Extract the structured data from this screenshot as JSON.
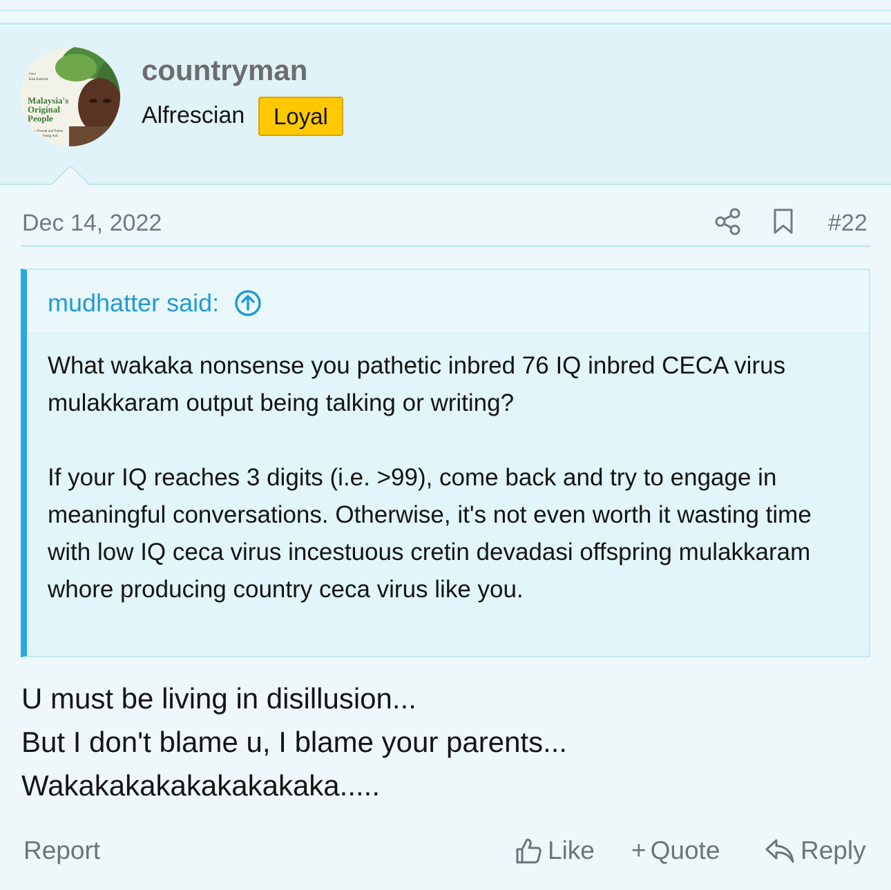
{
  "user": {
    "name": "countryman",
    "title": "Alfrescian",
    "badge": "Loyal",
    "avatar": {
      "cover_title_lines": [
        "Malaysia's",
        "Original",
        "People"
      ],
      "cover_subtitle_lines": [
        "t, Present and Future",
        "Orang Asli"
      ],
      "cover_editor_lines": [
        "Editor",
        "Kirk Endicott"
      ]
    }
  },
  "post": {
    "date": "Dec 14, 2022",
    "number": "#22",
    "quote": {
      "author": "mudhatter said:",
      "paragraphs": [
        "What wakaka nonsense you pathetic inbred 76 IQ inbred CECA virus mulakkaram output being talking or writing?",
        "If your IQ reaches 3 digits (i.e. >99), come back and try to engage in meaningful conversations. Otherwise, it's not even worth it wasting time with low IQ ceca virus incestuous cretin devadasi offspring mulakkaram whore producing country ceca virus like you."
      ]
    },
    "body_lines": [
      "U must be living in disillusion...",
      "But I don't blame u, I blame your parents...",
      "Wakakakakakakakakaka....."
    ]
  },
  "footer": {
    "report": "Report",
    "like": "Like",
    "quote": "Quote",
    "quote_prefix": "+",
    "reply": "Reply"
  },
  "colors": {
    "accent": "#28a7e3",
    "badge": "#ffc800",
    "panel": "#dff3f8"
  },
  "icons": [
    "share-icon",
    "bookmark-icon",
    "arrow-up-circle-icon",
    "thumbs-up-icon",
    "reply-icon"
  ]
}
